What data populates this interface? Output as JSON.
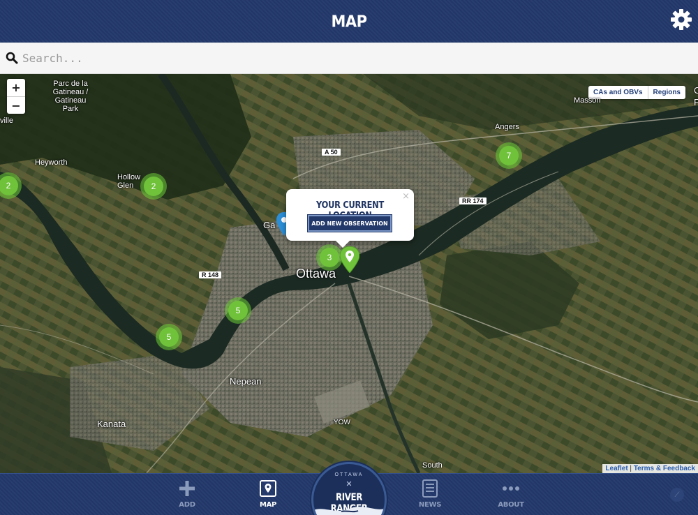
{
  "header": {
    "title": "MAP",
    "settings_icon": "gear-icon"
  },
  "search": {
    "placeholder": "Search...",
    "value": ""
  },
  "map": {
    "zoom_in": "+",
    "zoom_out": "−",
    "layers": [
      "CAs and OBVs",
      "Regions"
    ],
    "places": {
      "gatineau_park": "Parc de la Gatineau / Gatineau Park",
      "ville": "ville",
      "heyworth": "Heyworth",
      "hollow_glen": "Hollow Glen",
      "masson": "Masson",
      "angers": "Angers",
      "gatineau_partial": "Ga",
      "ottawa": "Ottawa",
      "nepean": "Nepean",
      "kanata": "Kanata",
      "south": "South",
      "yow": "YOW",
      "edge_c": "C",
      "edge_f": "F"
    },
    "roads": {
      "a50": "A 50",
      "rr174": "RR 174",
      "r148": "R 148"
    },
    "clusters": [
      {
        "id": "c1",
        "count": "2"
      },
      {
        "id": "c2",
        "count": "2"
      },
      {
        "id": "c3",
        "count": "7"
      },
      {
        "id": "c4",
        "count": "3"
      },
      {
        "id": "c5",
        "count": "5"
      },
      {
        "id": "c6",
        "count": "5"
      }
    ],
    "popup": {
      "title": "YOUR CURRENT LOCATION",
      "button": "ADD NEW OBSERVATION",
      "close": "×"
    },
    "attribution": {
      "leaflet": "Leaflet",
      "separator": " | ",
      "terms": "Terms & Feedback"
    }
  },
  "nav": {
    "items": [
      {
        "label": "ADD",
        "icon": "plus-icon",
        "active": false
      },
      {
        "label": "MAP",
        "icon": "map-pin-icon",
        "active": true
      },
      {
        "label": "NEWS",
        "icon": "news-icon",
        "active": false
      },
      {
        "label": "ABOUT",
        "icon": "more-dots-icon",
        "active": false
      }
    ],
    "logo": {
      "top": "OTTAWA",
      "x": "✕",
      "name": "RIVER RANGER"
    }
  }
}
